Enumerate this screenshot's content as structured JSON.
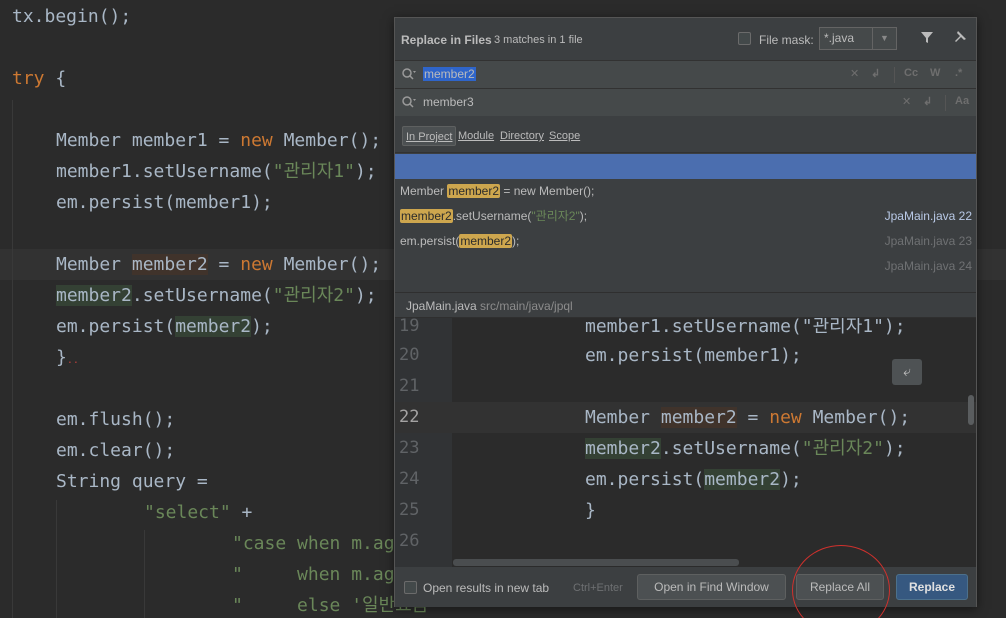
{
  "editor": {
    "lines": {
      "tx_begin": "tx.begin();",
      "try_kw": "try",
      "try_brace": " {",
      "m1_type": "Member ",
      "m1_var": "member1",
      "m1_eq": " = ",
      "m1_new": "new",
      "m1_ctor": " Member();",
      "m1_set_a": "member1.setUsername(",
      "m1_set_str": "\"관리자1\"",
      "m1_set_b": ");",
      "m1_persist": "em.persist(member1);",
      "m2_type": "Member ",
      "m2_var": "member2",
      "m2_eq": " = ",
      "m2_new": "new",
      "m2_ctor": " Member();",
      "m2_set_var": "member2",
      "m2_set_a": ".setUsername(",
      "m2_set_str": "\"관리자2\"",
      "m2_set_b": ");",
      "m2_persist_a": "em.persist(",
      "m2_persist_var": "member2",
      "m2_persist_b": ");",
      "close_brace": "}",
      "flush": "em.flush();",
      "clear": "em.clear();",
      "query": "String query =",
      "select_str": "\"select\"",
      "select_plus": " +",
      "case_str": "\"case when m.ag",
      "when_str": "\"     when m.ag",
      "else_str": "\"     else '일반요금"
    }
  },
  "dialog": {
    "title": "Replace in Files",
    "match_count": "3 matches in 1 file",
    "file_mask_label": "File mask:",
    "file_mask_value": "*.java",
    "file_mask_checked": false,
    "search_value": "member2",
    "replace_value": "member3",
    "search_options": [
      "Cc",
      "W",
      ".*"
    ],
    "replace_options": [
      "Aa"
    ],
    "scopes": [
      "In Project",
      "Module",
      "Directory",
      "Scope"
    ],
    "active_scope": "In Project",
    "results": [
      {
        "before": "Member ",
        "match": "member2",
        "after": " = new Member();",
        "file": "JpaMain.java 22"
      },
      {
        "before": "",
        "match": "member2",
        "after": ".setUsername(",
        "str": "\"관리자2\"",
        "tail": ");",
        "file": "JpaMain.java 23"
      },
      {
        "before": "em.persist(",
        "match": "member2",
        "after": ");",
        "file": "JpaMain.java 24"
      }
    ],
    "preview_path_file": "JpaMain.java",
    "preview_path_dir": "src/main/java/jpql",
    "preview": {
      "l19_num": "19",
      "l19": "member1.setUsername(\"관리자1\");",
      "l20_num": "20",
      "l20": "em.persist(member1);",
      "l21_num": "21",
      "l22_num": "22",
      "l22_type": "Member ",
      "l22_var": "member2",
      "l22_eq": " = ",
      "l22_new": "new",
      "l22_ctor": " Member();",
      "l23_num": "23",
      "l23_var": "member2",
      "l23_a": ".setUsername(",
      "l23_str": "\"관리자2\"",
      "l23_b": ");",
      "l24_num": "24",
      "l24_a": "em.persist(",
      "l24_var": "member2",
      "l24_b": ");",
      "l25_num": "25",
      "l25": "}",
      "l26_num": "26"
    },
    "footer": {
      "open_in_new_tab": "Open results in new tab",
      "open_in_new_tab_checked": false,
      "shortcut": "Ctrl+Enter",
      "open_find_window": "Open in Find Window",
      "replace_all": "Replace All",
      "replace": "Replace"
    }
  },
  "colors": {
    "editor_bg": "#2b2b2b",
    "dialog_bg": "#3c3f41",
    "keyword": "#cc7832",
    "string": "#6a8759",
    "selection": "#4b6eaf",
    "match": "#cda64e",
    "primary_button": "#365880",
    "annotation": "#d0312d"
  }
}
